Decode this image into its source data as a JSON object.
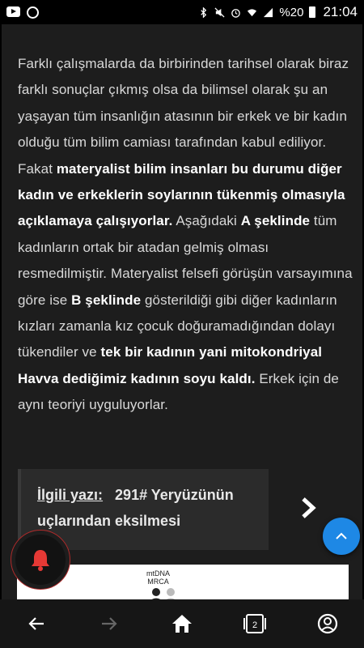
{
  "status_bar": {
    "icons_left": [
      "youtube-icon",
      "whatsapp-icon"
    ],
    "icons_right": [
      "bluetooth-icon",
      "mute-icon",
      "alarm-icon",
      "wifi-icon",
      "signal-icon"
    ],
    "battery": "%20",
    "time": "21:04"
  },
  "article": {
    "segments": [
      {
        "text": "Farklı çalışmalarda da birbirinden tarihsel olarak biraz farklı sonuçlar çıkmış olsa da bilimsel olarak şu an yaşayan tüm insanlığın atasının bir erkek ve bir kadın olduğu tüm bilim camiası tarafından kabul ediliyor. Fakat ",
        "bold": false
      },
      {
        "text": "materyalist bilim insanları bu durumu diğer kadın ve erkeklerin soylarının tükenmiş olmasıyla açıklamaya çalışıyorlar.",
        "bold": true
      },
      {
        "text": " Aşağıdaki ",
        "bold": false
      },
      {
        "text": "A şeklinde",
        "bold": true
      },
      {
        "text": " tüm kadınların ortak bir atadan gelmiş olması resmedilmiştir. Materyalist felsefi görüşün varsayımına göre ise ",
        "bold": false
      },
      {
        "text": "B şeklinde",
        "bold": true
      },
      {
        "text": " gösterildiği gibi diğer kadınların kızları zamanla kız çocuk doğuramadığından dolayı tükendiler ve ",
        "bold": false
      },
      {
        "text": "tek bir kadının yani mitokondriyal Havva dediğimiz kadının soyu kaldı.",
        "bold": true
      },
      {
        "text": " Erkek için de aynı teoriyi uyguluyorlar.",
        "bold": false
      }
    ]
  },
  "related": {
    "label": "İlgili yazı:",
    "title": "291# Yeryüzünün uçlarından eksilmesi",
    "next_icon": "chevron-right-icon"
  },
  "figure": {
    "label_line1": "mtDNA",
    "label_line2": "MRCA"
  },
  "buttons": {
    "bell_icon": "bell-icon",
    "scroll_top_icon": "chevron-up-icon"
  },
  "bottom_nav": {
    "items": [
      {
        "icon": "back-arrow-icon"
      },
      {
        "icon": "forward-arrow-icon"
      },
      {
        "icon": "home-icon"
      },
      {
        "icon": "tabs-icon",
        "count": "2"
      },
      {
        "icon": "account-icon"
      }
    ]
  },
  "colors": {
    "background": "#000000",
    "card": "#1d1d1d",
    "accent_blue": "#1e88e5",
    "bell_red": "#e53935"
  }
}
